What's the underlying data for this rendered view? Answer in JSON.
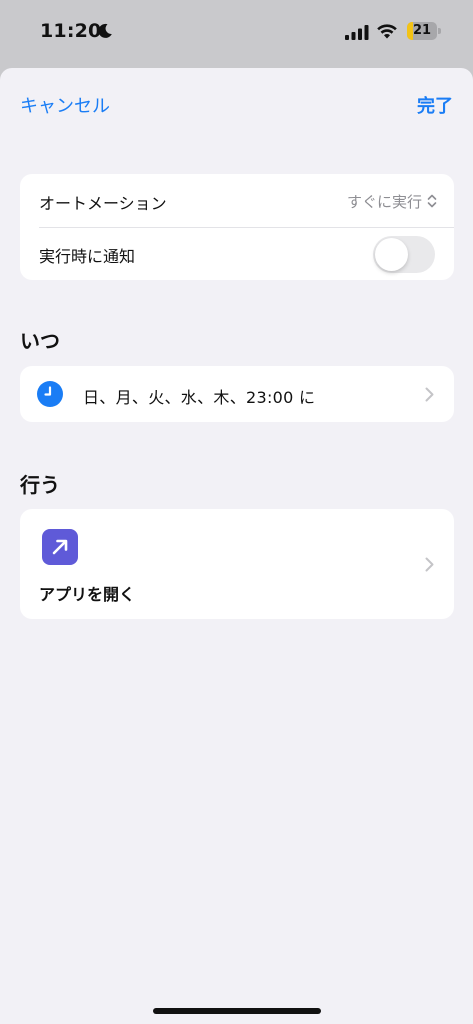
{
  "status_bar": {
    "time": "11:20",
    "battery_level": "21",
    "battery_fraction": 0.21,
    "icons": [
      "moon-icon",
      "cellular-signal-icon",
      "wifi-icon",
      "battery-icon"
    ]
  },
  "nav": {
    "cancel_label": "キャンセル",
    "done_label": "完了"
  },
  "settings": {
    "automation_label": "オートメーション",
    "automation_value": "すぐに実行",
    "notify_label": "実行時に通知",
    "notify_on": false
  },
  "when": {
    "section_title": "いつ",
    "schedule": "日、月、火、水、木、23:00 に"
  },
  "do": {
    "section_title": "行う",
    "action_label": "アプリを開く"
  },
  "colors": {
    "accent": "#1a7df5",
    "sheet_background": "#f2f1f6",
    "action_icon": "#5f5ad8",
    "battery_fill": "#f3c316"
  }
}
